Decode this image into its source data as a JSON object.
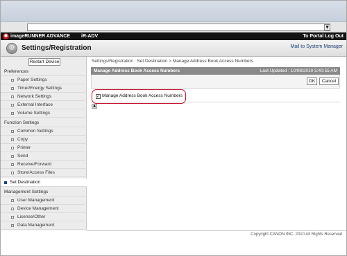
{
  "address_bar": {
    "value": "",
    "dropdown_glyph": "▼"
  },
  "topbar": {
    "product": "imageRUNNER ADVANCE",
    "model": "iR-ADV",
    "portal_link": "To Portal Log Out",
    "logo_icon": "canon-logo-icon"
  },
  "header": {
    "title": "Settings/Registration",
    "mail_button": "Mail to System Manager",
    "icon": "settings-icon"
  },
  "sidebar": {
    "restart_button": "Restart Device",
    "categories": [
      {
        "label": "Preferences",
        "items": [
          "Paper Settings",
          "Timer/Energy Settings",
          "Network Settings",
          "External Interface",
          "Volume Settings"
        ]
      },
      {
        "label": "Function Settings",
        "items": [
          "Common Settings",
          "Copy",
          "Printer",
          "Send",
          "Receive/Forward",
          "Store/Access Files"
        ]
      },
      {
        "label": "Set Destination",
        "active": true
      },
      {
        "label": "Management Settings",
        "items": [
          "User Management",
          "Device Management",
          "License/Other",
          "Data Management"
        ]
      }
    ]
  },
  "breadcrumb": "Settings/Registration : Set Destination > Manage Address Book Access Numbers",
  "panel": {
    "title": "Manage Address Book Access Numbers",
    "last_updated": "Last Updated : 10/08/2010 5:40:55 AM",
    "ok_button": "OK",
    "cancel_button": "Cancel",
    "checkbox_label": "Manage Address Book Access Numbers",
    "checkbox_checked": true,
    "checkbox_glyph": "✓",
    "up_glyph": "▲"
  },
  "footer": "Copyright CANON INC. 2010 All Rights Reserved",
  "colors": {
    "accent_red": "#c8102e",
    "dark_bar": "#131313",
    "panel_head": "#8a8a8a"
  }
}
